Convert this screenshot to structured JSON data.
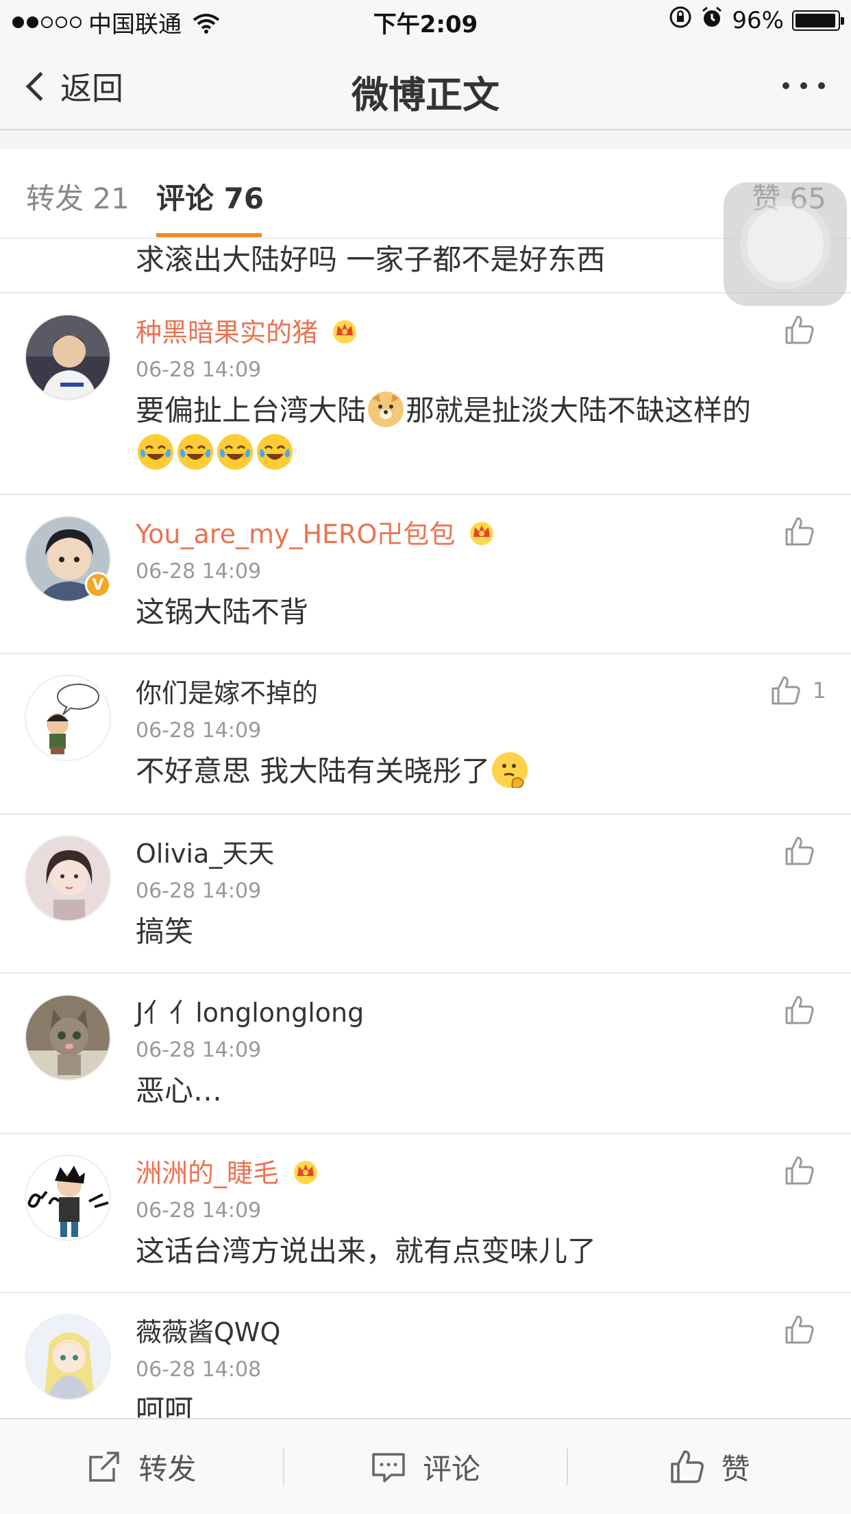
{
  "status_bar": {
    "carrier": "中国联通",
    "time": "下午2:09",
    "battery": "96%",
    "battery_level": 0.96,
    "signal_bars": 2
  },
  "nav": {
    "back_label": "返回",
    "title": "微博正文"
  },
  "tabs": {
    "repost": "转发 21",
    "comments": "评论 76",
    "likes": "赞 65"
  },
  "partial_comment": {
    "text": "求滚出大陆好吗  一家子都不是好东西"
  },
  "comments": [
    {
      "username": "种黑暗果实的猪",
      "vip": true,
      "time": "06-28 14:09",
      "text_a": "要偏扯上台湾大陆",
      "text_b": "那就是扯淡大陆不缺这样的",
      "emojis": [
        "doge",
        "laugh",
        "laugh",
        "laugh",
        "laugh"
      ],
      "likes": ""
    },
    {
      "username": "You_are_my_HERO卍包包",
      "vip": true,
      "verified": "V",
      "time": "06-28 14:09",
      "text": "这锅大陆不背",
      "likes": ""
    },
    {
      "username": "你们是嫁不掉的",
      "vip": false,
      "time": "06-28 14:09",
      "text": "不好意思 我大陆有关晓彤了",
      "emojis": [
        "think"
      ],
      "likes": "1"
    },
    {
      "username": "Olivia_天天",
      "vip": false,
      "time": "06-28 14:09",
      "text": "搞笑",
      "likes": ""
    },
    {
      "username": "J亻亻longlonglong",
      "vip": false,
      "time": "06-28 14:09",
      "text": "恶心…",
      "likes": ""
    },
    {
      "username": "洲洲的_睫毛",
      "vip": true,
      "time": "06-28 14:09",
      "text": "这话台湾方说出来，就有点变味儿了",
      "likes": ""
    },
    {
      "username": "薇薇酱QWQ",
      "vip": false,
      "time": "06-28 14:08",
      "text": "呵呵",
      "likes": ""
    }
  ],
  "toolbar": {
    "repost": "转发",
    "comment": "评论",
    "like": "赞"
  },
  "colors": {
    "accent": "#f08a24",
    "vip_name": "#eb7350",
    "verified": "#f5a623"
  }
}
